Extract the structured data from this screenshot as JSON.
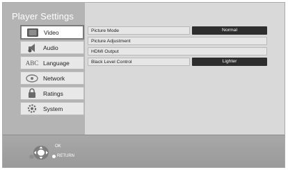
{
  "header": {
    "title": "Player Settings"
  },
  "menu": [
    {
      "label": "Video",
      "icon": "video-icon",
      "selected": true
    },
    {
      "label": "Audio",
      "icon": "audio-icon"
    },
    {
      "label": "Language",
      "icon": "language-icon",
      "icon_text": "ABC"
    },
    {
      "label": "Network",
      "icon": "network-icon"
    },
    {
      "label": "Ratings",
      "icon": "ratings-icon"
    },
    {
      "label": "System",
      "icon": "system-icon"
    }
  ],
  "settings": [
    {
      "label": "Picture Mode",
      "value": "Normal"
    },
    {
      "label": "Picture Adjustment"
    },
    {
      "label": "HDMI Output"
    },
    {
      "label": "Black Level Control",
      "value": "Lighter"
    }
  ],
  "footer": {
    "ok_label": "OK",
    "return_label": "RETURN"
  },
  "colors": {
    "value_bg": "#2e2e2e",
    "panel_bg": "#d9d9d9",
    "sidebar_bg": "#b4b4b4"
  }
}
